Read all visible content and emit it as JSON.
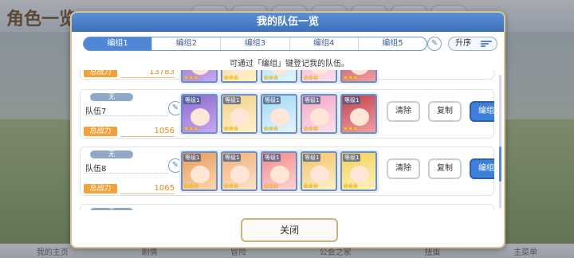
{
  "background": {
    "logo_text": "角色一览",
    "bottom_nav": [
      "我的主页",
      "剧情",
      "冒险",
      "公会之家",
      "扭蛋",
      "主菜单"
    ]
  },
  "modal": {
    "title": "我的队伍一览",
    "tabs": [
      {
        "label": "编组1",
        "active": true
      },
      {
        "label": "编组2",
        "active": false
      },
      {
        "label": "编组3",
        "active": false
      },
      {
        "label": "编组4",
        "active": false
      },
      {
        "label": "编组5",
        "active": false
      }
    ],
    "sort_label": "升序",
    "hint": "可通过「编组」键登记我的队伍。",
    "power_label": "总战力",
    "level_text": "等级1",
    "stars_text": "★★★",
    "mode_text": "无",
    "teams": [
      {
        "name": "",
        "power": "13783"
      },
      {
        "name": "队伍7",
        "power": "1056"
      },
      {
        "name": "队伍8",
        "power": "1065"
      }
    ],
    "actions": {
      "clear": "清除",
      "copy": "复制",
      "edit": "编组"
    },
    "close": "关闭"
  },
  "colors": {
    "accent": "#3f7fdc",
    "power_badge": "#f3a23a",
    "power_value": "#e08a1e",
    "slot_palettes": [
      [
        "#8a6bd0",
        "#c9a7f0"
      ],
      [
        "#f2d38a",
        "#fff1c8"
      ],
      [
        "#9fd9f2",
        "#e4f6ff"
      ],
      [
        "#f3a7c4",
        "#ffe0ec"
      ],
      [
        "#c0404a",
        "#f0a0a8"
      ],
      [
        "#e69a5a",
        "#ffd6b0"
      ],
      [
        "#f0b07a",
        "#ffe2c6"
      ],
      [
        "#f08a8a",
        "#ffd3d3"
      ],
      [
        "#f3c26a",
        "#fff0c6"
      ],
      [
        "#f2cf5a",
        "#fff3b8"
      ]
    ]
  }
}
